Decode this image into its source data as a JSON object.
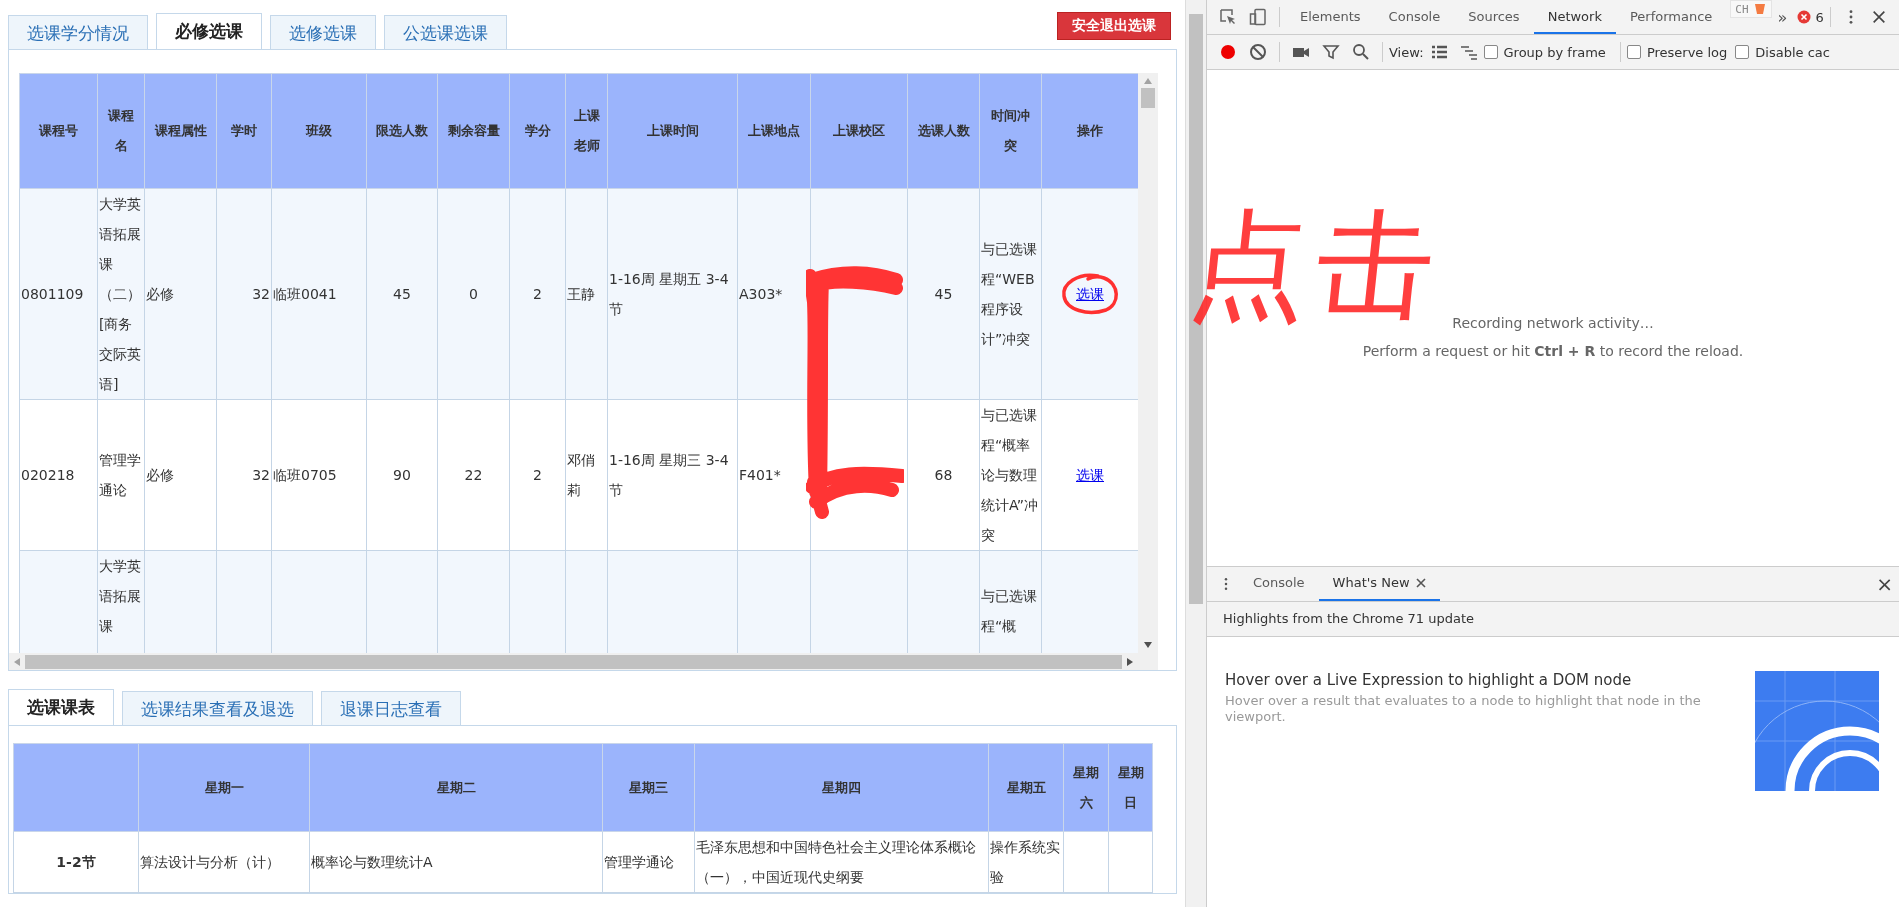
{
  "page_tabs": [
    {
      "label": "选课学分情况",
      "selected": false
    },
    {
      "label": "必修选课",
      "selected": true
    },
    {
      "label": "选修选课",
      "selected": false
    },
    {
      "label": "公选课选课",
      "selected": false
    }
  ],
  "exit_button": "安全退出选课",
  "course_table": {
    "columns": [
      "课程号",
      "课程名",
      "课程属性",
      "学时",
      "班级",
      "限选人数",
      "剩余容量",
      "学分",
      "上课老师",
      "上课时间",
      "上课地点",
      "上课校区",
      "选课人数",
      "时间冲突",
      "操作"
    ],
    "rows": [
      {
        "course_no": "0801109",
        "name": "大学英语拓展课（二）[商务交际英语]",
        "type": "必修",
        "hours": "32",
        "class": "临班0041",
        "limit": "45",
        "remaining": "0",
        "credit": "2",
        "teacher": "王静",
        "time": "1-16周 星期五 3-4节",
        "room": "A303*",
        "enrolled": "45",
        "conflict": "与已选课程“WEB程序设计”冲突",
        "action": "选课",
        "circled": true
      },
      {
        "course_no": "020218",
        "name": "管理学通论",
        "type": "必修",
        "hours": "32",
        "class": "临班0705",
        "limit": "90",
        "remaining": "22",
        "credit": "2",
        "teacher": "邓俏莉",
        "time": "1-16周 星期三 3-4节",
        "room": "F401*",
        "enrolled": "68",
        "conflict": "与已选课程“概率论与数理统计A”冲突",
        "action": "选课",
        "circled": false
      },
      {
        "name": "大学英语拓展课",
        "conflict": "与已选课程“概",
        "circled": false
      }
    ]
  },
  "annotation": {
    "text": "点击"
  },
  "schedule_tabs": [
    {
      "label": "选课课表",
      "selected": true
    },
    {
      "label": "选课结果查看及退选",
      "selected": false
    },
    {
      "label": "退课日志查看",
      "selected": false
    }
  ],
  "timetable": {
    "columns": [
      "星期一",
      "星期二",
      "星期三",
      "星期四",
      "星期五",
      "星期六",
      "星期日"
    ],
    "rows": [
      {
        "period": "1-2节",
        "cells": [
          "算法设计与分析（计）",
          "概率论与数理统计A",
          "管理学通论",
          "毛泽东思想和中国特色社会主义理论体系概论（一），中国近现代史纲要",
          "操作系统实验"
        ]
      }
    ]
  },
  "devtools": {
    "tabs": [
      {
        "label": "Elements",
        "selected": false
      },
      {
        "label": "Console",
        "selected": false
      },
      {
        "label": "Sources",
        "selected": false
      },
      {
        "label": "Network",
        "selected": true
      },
      {
        "label": "Performance",
        "selected": false
      }
    ],
    "more": "»",
    "ime_indicator": "CH",
    "error_count": "6",
    "toolbar": {
      "recording": true,
      "view_label": "View:",
      "checkboxes": [
        {
          "label": "Group by frame",
          "checked": false
        },
        {
          "label": "Preserve log",
          "checked": false
        },
        {
          "label": "Disable cac",
          "checked": false
        }
      ]
    },
    "messages": [
      "Recording network activity…",
      "Perform a request or hit **Ctrl + R** to record the reload."
    ],
    "drawer": {
      "tabs": [
        {
          "label": "Console",
          "selected": false,
          "closable": false
        },
        {
          "label": "What's New",
          "selected": true,
          "closable": true
        }
      ],
      "close": "×",
      "banner": "Highlights from the Chrome 71 update",
      "item": {
        "title": "Hover over a Live Expression to highlight a DOM node",
        "description": "Hover over a result that evaluates to a node to highlight that node in the viewport.",
        "kind": "picture"
      }
    }
  }
}
